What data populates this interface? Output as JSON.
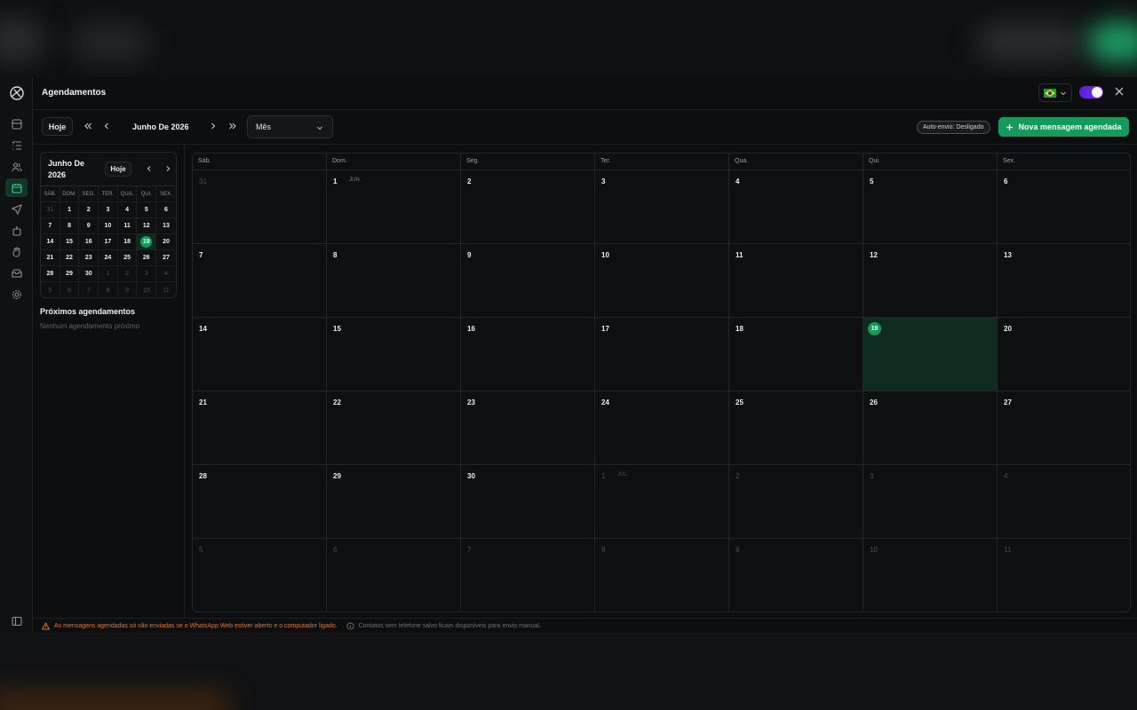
{
  "header": {
    "title": "Agendamentos"
  },
  "toolbar": {
    "today_label": "Hoje",
    "period_label": "Junho De 2026",
    "view_select": "Mês",
    "auto_send_badge": "Auto-envio: Desligado",
    "new_message_button": "Nova mensagem agendada"
  },
  "mini_calendar": {
    "title": "Junho De 2026",
    "today_label": "Hoje",
    "weekdays": [
      "SÁB.",
      "DOM.",
      "SEG.",
      "TER.",
      "QUA.",
      "QUI.",
      "SEX."
    ],
    "weeks": [
      [
        {
          "d": "31",
          "m": true
        },
        {
          "d": "1"
        },
        {
          "d": "2"
        },
        {
          "d": "3"
        },
        {
          "d": "4"
        },
        {
          "d": "5"
        },
        {
          "d": "6"
        }
      ],
      [
        {
          "d": "7"
        },
        {
          "d": "8"
        },
        {
          "d": "9"
        },
        {
          "d": "10"
        },
        {
          "d": "11"
        },
        {
          "d": "12"
        },
        {
          "d": "13"
        }
      ],
      [
        {
          "d": "14"
        },
        {
          "d": "15"
        },
        {
          "d": "16"
        },
        {
          "d": "17"
        },
        {
          "d": "18"
        },
        {
          "d": "19",
          "today": true
        },
        {
          "d": "20"
        }
      ],
      [
        {
          "d": "21"
        },
        {
          "d": "22"
        },
        {
          "d": "23"
        },
        {
          "d": "24"
        },
        {
          "d": "25"
        },
        {
          "d": "26"
        },
        {
          "d": "27"
        }
      ],
      [
        {
          "d": "28"
        },
        {
          "d": "29"
        },
        {
          "d": "30"
        },
        {
          "d": "1",
          "m": true
        },
        {
          "d": "2",
          "m": true
        },
        {
          "d": "3",
          "m": true
        },
        {
          "d": "4",
          "m": true
        }
      ],
      [
        {
          "d": "5",
          "m": true
        },
        {
          "d": "6",
          "m": true
        },
        {
          "d": "7",
          "m": true
        },
        {
          "d": "8",
          "m": true
        },
        {
          "d": "9",
          "m": true
        },
        {
          "d": "10",
          "m": true
        },
        {
          "d": "11",
          "m": true
        }
      ]
    ]
  },
  "upcoming": {
    "title": "Próximos agendamentos",
    "empty": "Nenhum agendamento próximo"
  },
  "calendar": {
    "weekdays": [
      "Sáb.",
      "Dom.",
      "Seg.",
      "Ter.",
      "Qua.",
      "Qui.",
      "Sex."
    ],
    "weeks": [
      [
        {
          "d": "31",
          "m": true
        },
        {
          "d": "1",
          "mon": "JUN."
        },
        {
          "d": "2"
        },
        {
          "d": "3"
        },
        {
          "d": "4"
        },
        {
          "d": "5"
        },
        {
          "d": "6"
        }
      ],
      [
        {
          "d": "7"
        },
        {
          "d": "8"
        },
        {
          "d": "9"
        },
        {
          "d": "10"
        },
        {
          "d": "11"
        },
        {
          "d": "12"
        },
        {
          "d": "13"
        }
      ],
      [
        {
          "d": "14"
        },
        {
          "d": "15"
        },
        {
          "d": "16"
        },
        {
          "d": "17"
        },
        {
          "d": "18"
        },
        {
          "d": "19",
          "today": true
        },
        {
          "d": "20"
        }
      ],
      [
        {
          "d": "21"
        },
        {
          "d": "22"
        },
        {
          "d": "23"
        },
        {
          "d": "24"
        },
        {
          "d": "25"
        },
        {
          "d": "26"
        },
        {
          "d": "27"
        }
      ],
      [
        {
          "d": "28"
        },
        {
          "d": "29"
        },
        {
          "d": "30"
        },
        {
          "d": "1",
          "mon": "JUL.",
          "m": true
        },
        {
          "d": "2",
          "m": true
        },
        {
          "d": "3",
          "m": true
        },
        {
          "d": "4",
          "m": true
        }
      ],
      [
        {
          "d": "5",
          "m": true
        },
        {
          "d": "6",
          "m": true
        },
        {
          "d": "7",
          "m": true
        },
        {
          "d": "8",
          "m": true
        },
        {
          "d": "9",
          "m": true
        },
        {
          "d": "10",
          "m": true
        },
        {
          "d": "11",
          "m": true
        }
      ]
    ]
  },
  "footer": {
    "warning": "As mensagens agendadas só são enviadas se o WhatsApp Web estiver aberto e o computador ligado.",
    "info": "Contatos sem telefone salvo ficam disponíveis para envio manual."
  },
  "colors": {
    "accent": "#169a5c",
    "warning": "#f0731f",
    "toggle": "#6a28e6"
  },
  "icons": [
    "app-logo-icon",
    "inbox-icon",
    "list-check-icon",
    "contacts-icon",
    "calendar-icon",
    "send-icon",
    "bot-icon",
    "hand-icon",
    "archive-icon",
    "settings-icon",
    "sidebar-toggle-icon",
    "brazil-flag-icon",
    "close-icon",
    "plus-icon",
    "warning-icon",
    "info-icon"
  ]
}
